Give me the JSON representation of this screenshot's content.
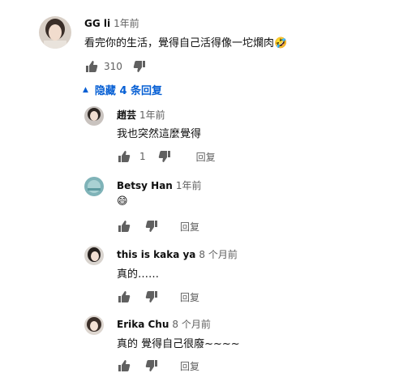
{
  "main_comment": {
    "author": "GG li",
    "time": "1年前",
    "text": "看完你的生活，覺得自己活得像一坨爛肉🤣",
    "likes": "310"
  },
  "replies_toggle": {
    "label": "隐藏 4 条回复"
  },
  "reply_label": "回复",
  "replies": [
    {
      "author": "趙芸",
      "time": "1年前",
      "text": "我也突然這麼覺得",
      "likes": "1"
    },
    {
      "author": "Betsy Han",
      "time": "1年前",
      "text": "😄",
      "likes": ""
    },
    {
      "author": "this is kaka ya",
      "time": "8 个月前",
      "text": "真的……",
      "likes": ""
    },
    {
      "author": "Erika Chu",
      "time": "8 个月前",
      "text": "真的 覺得自己很廢~~~~",
      "likes": ""
    }
  ],
  "colors": {
    "link_blue": "#065fd4",
    "secondary_text": "#606060",
    "icon": "#606060",
    "primary_text": "#0f0f0f"
  }
}
